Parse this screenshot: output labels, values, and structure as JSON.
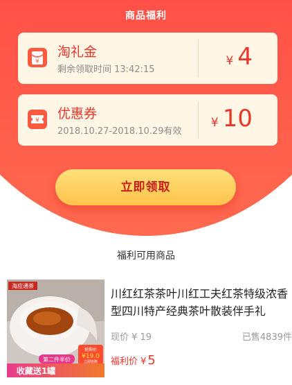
{
  "header": {
    "title": "商品福利"
  },
  "cards": [
    {
      "icon": "red-envelope-icon",
      "name": "淘礼金",
      "subtitle": "剩余领取时间 13:42:15",
      "currency": "¥",
      "amount": "4"
    },
    {
      "icon": "ticket-icon",
      "name": "优惠券",
      "subtitle": "2018.10.27-2018.10.29有效",
      "currency": "¥",
      "amount": "10"
    }
  ],
  "claim_button": {
    "label": "立即领取"
  },
  "section": {
    "title": "福利可用商品"
  },
  "product": {
    "name": "川红红茶茶叶川红工夫红茶特级浓香型四川特产经典茶叶散装伴手礼",
    "price_label": "现价 ¥ 19",
    "sold_label": "已售4839件",
    "fuli_label": "福利价 ¥",
    "fuli_value": "5",
    "thumb": {
      "badge_logo": "海应通茶",
      "badge_promo": "抢购价",
      "badge_price": "¥19.0",
      "badge_cta": "立即抢购",
      "banner_tag": "第二件半价",
      "banner_text": "收藏送1罐"
    }
  },
  "colors": {
    "accent": "#e8362b",
    "hero": "#ff5a40",
    "card_bg": "#fff6e6",
    "button": "#ffc24a"
  }
}
